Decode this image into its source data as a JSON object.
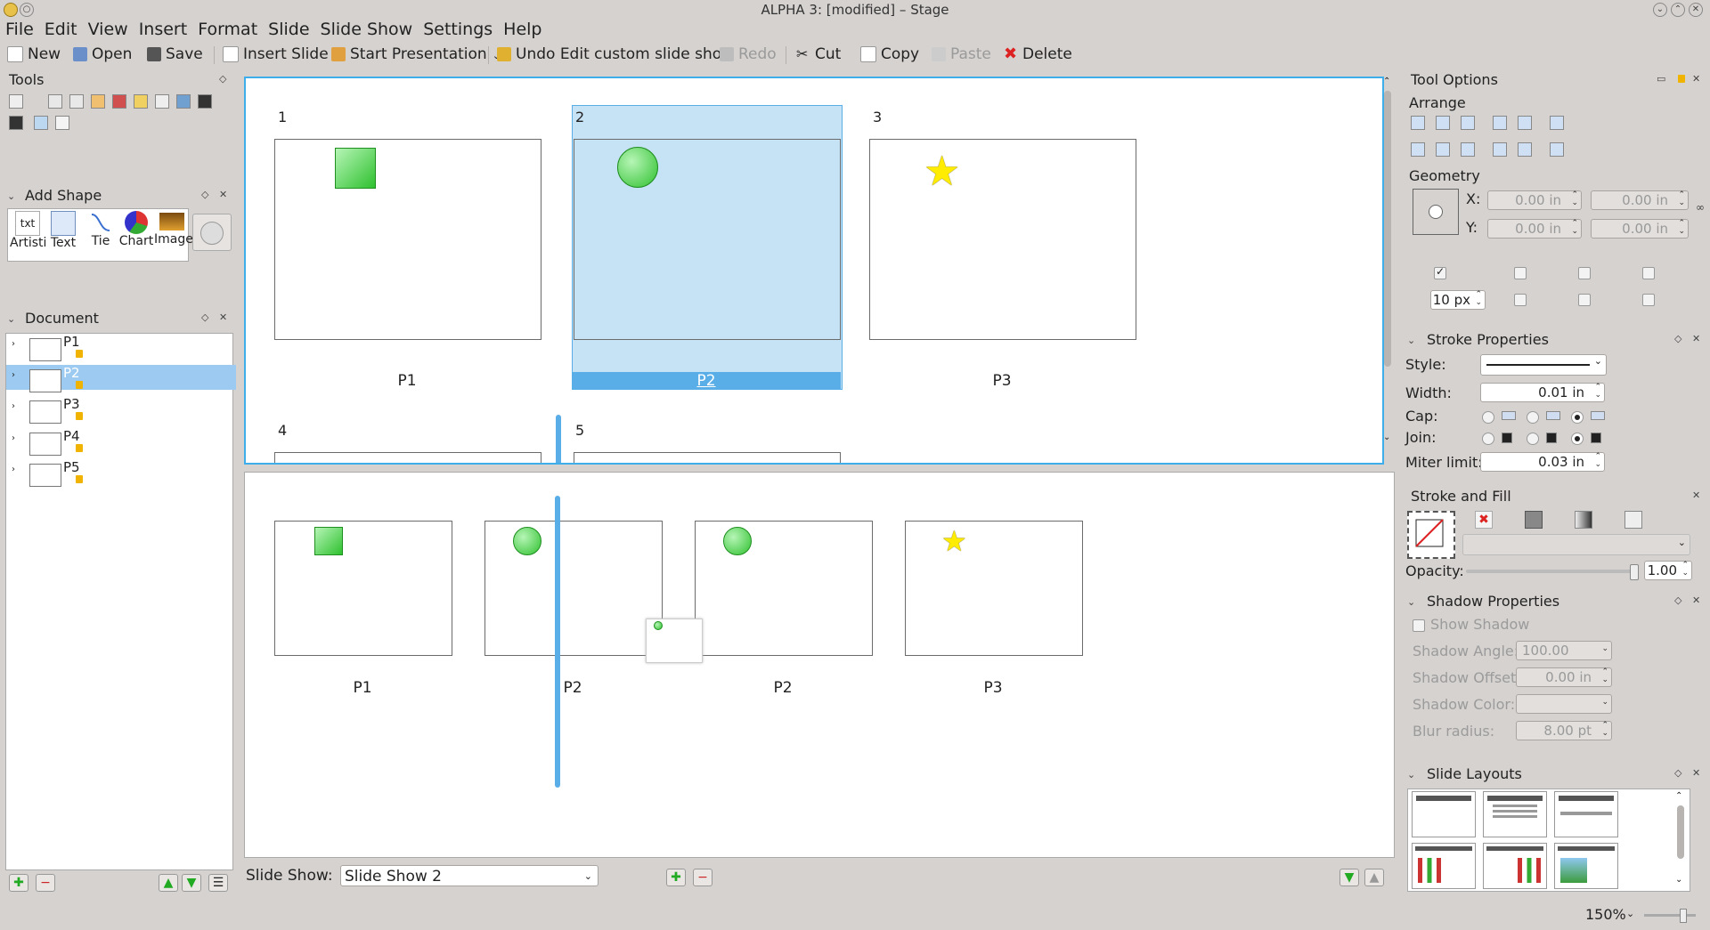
{
  "window": {
    "title": "ALPHA 3:  [modified] – Stage"
  },
  "menu": [
    "File",
    "Edit",
    "View",
    "Insert",
    "Format",
    "Slide",
    "Slide Show",
    "Settings",
    "Help"
  ],
  "toolbar": {
    "new": "New",
    "open": "Open",
    "save": "Save",
    "insert_slide": "Insert Slide",
    "start_presentation": "Start Presentation",
    "undo": "Undo Edit custom slide show",
    "redo": "Redo",
    "cut": "Cut",
    "copy": "Copy",
    "paste": "Paste",
    "delete": "Delete"
  },
  "tools_panel": {
    "title": "Tools"
  },
  "add_shape": {
    "title": "Add Shape",
    "items": [
      "Artisti",
      "Text",
      "Tie",
      "Chart",
      "Image"
    ]
  },
  "document_panel": {
    "title": "Document",
    "items": [
      "P1",
      "P2",
      "P3",
      "P4",
      "P5"
    ]
  },
  "slide_grid": {
    "slides": [
      {
        "num": "1",
        "label": "P1"
      },
      {
        "num": "2",
        "label": "P2"
      },
      {
        "num": "3",
        "label": "P3"
      },
      {
        "num": "4"
      },
      {
        "num": "5"
      }
    ]
  },
  "custom_show": {
    "labels": [
      "P1",
      "P2",
      "P2",
      "P3"
    ]
  },
  "slide_show_bar": {
    "label": "Slide Show:",
    "selected": "Slide Show 2"
  },
  "tool_options": {
    "title": "Tool Options",
    "arrange": "Arrange",
    "geometry": "Geometry",
    "x_label": "X:",
    "y_label": "Y:",
    "x_value": "0.00 in",
    "y_value": "0.00 in",
    "w_value": "0.00 in",
    "h_value": "0.00 in",
    "grid_size": "10 px"
  },
  "stroke_properties": {
    "title": "Stroke Properties",
    "style_label": "Style:",
    "width_label": "Width:",
    "width_value": "0.01 in",
    "cap_label": "Cap:",
    "join_label": "Join:",
    "miter_label": "Miter limit:",
    "miter_value": "0.03 in"
  },
  "stroke_fill": {
    "title": "Stroke and Fill",
    "opacity_label": "Opacity:",
    "opacity_value": "1.00"
  },
  "shadow": {
    "title": "Shadow Properties",
    "show_shadow": "Show Shadow",
    "angle_label": "Shadow Angle:",
    "angle_value": "100.00",
    "offset_label": "Shadow Offset:",
    "offset_value": "0.00 in",
    "color_label": "Shadow Color:",
    "blur_label": "Blur radius:",
    "blur_value": "8.00 pt"
  },
  "slide_layouts": {
    "title": "Slide Layouts"
  },
  "zoom": {
    "value": "150%"
  },
  "colors": {
    "selection": "#c6e2f5",
    "selection_bar": "#5aaee8",
    "accent_border": "#3daee9"
  }
}
